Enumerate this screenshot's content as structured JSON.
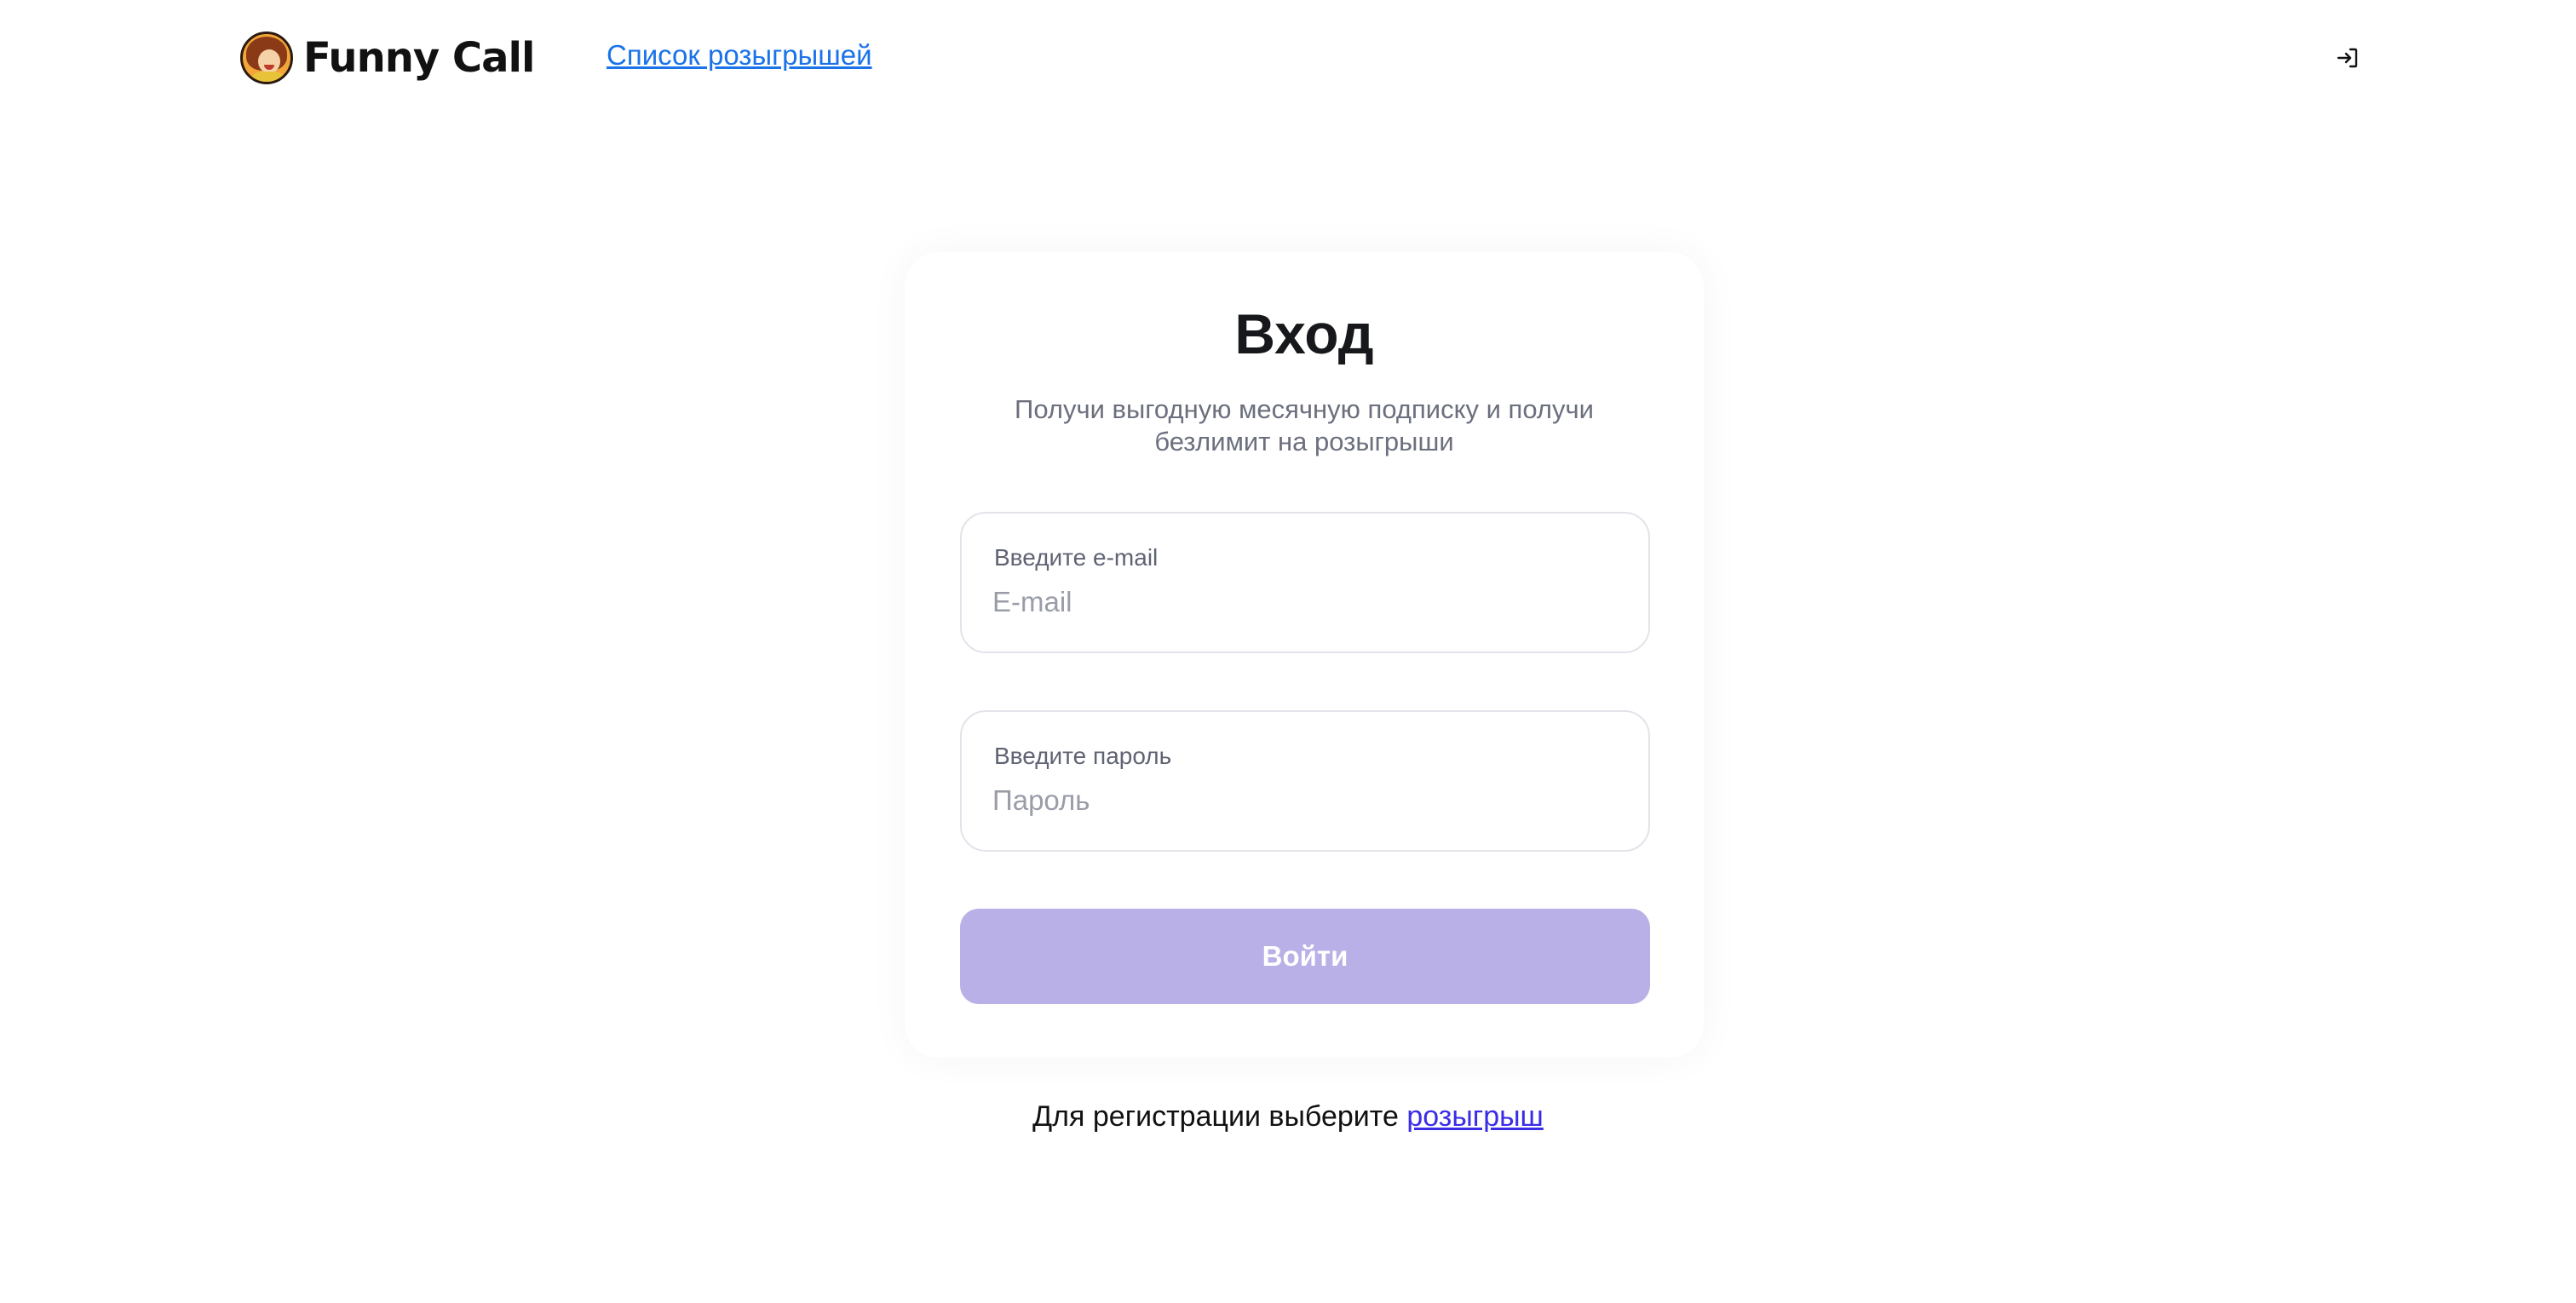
{
  "header": {
    "brand": "Funny Call",
    "logo_icon": "funny-call-mascot",
    "nav_link": "Список розыгрышей",
    "login_icon": "login-arrow-icon"
  },
  "login_form": {
    "title": "Вход",
    "subtitle": "Получи выгодную месячную подписку и получи безлимит на розыгрыши",
    "email": {
      "label": "Введите e-mail",
      "placeholder": "E-mail",
      "value": ""
    },
    "password": {
      "label": "Введите пароль",
      "placeholder": "Пароль",
      "value": ""
    },
    "submit_label": "Войти",
    "submit_disabled": true
  },
  "register": {
    "text": "Для регистрации выберите",
    "link": "розыгрыш"
  },
  "colors": {
    "primary_disabled": "#b8b0e6",
    "link_blue": "#1a73e8",
    "link_purple": "#3b2de6",
    "border": "#e2e4ea",
    "muted_text": "#6b6f7e"
  }
}
